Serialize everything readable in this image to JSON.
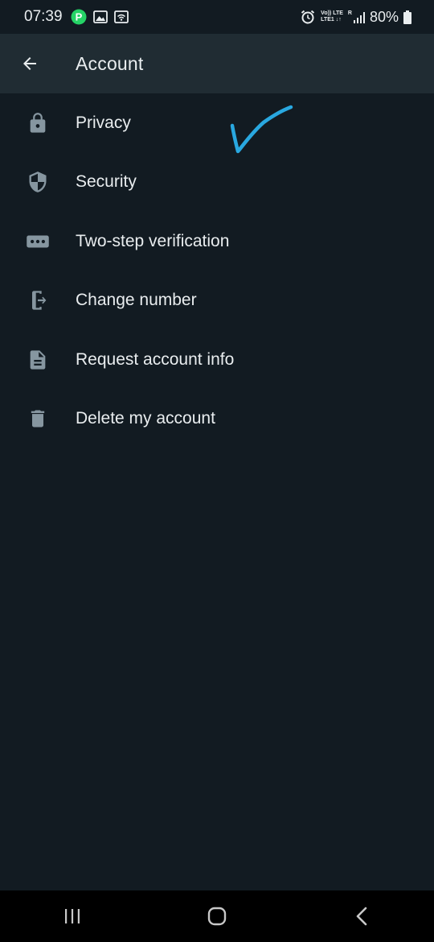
{
  "status_bar": {
    "time": "07:39",
    "battery_percent": "80%",
    "network_label_1": "Vo)) LTE",
    "network_label_2": "LTE1 ↓↑",
    "network_label_3": "R"
  },
  "app_bar": {
    "title": "Account"
  },
  "menu": {
    "items": [
      {
        "label": "Privacy",
        "icon": "lock-icon"
      },
      {
        "label": "Security",
        "icon": "shield-icon"
      },
      {
        "label": "Two-step verification",
        "icon": "dots-password-icon"
      },
      {
        "label": "Change number",
        "icon": "change-number-icon"
      },
      {
        "label": "Request account info",
        "icon": "document-icon"
      },
      {
        "label": "Delete my account",
        "icon": "trash-icon"
      }
    ]
  },
  "colors": {
    "background": "#121b22",
    "app_bar": "#202c33",
    "text": "#e9edef",
    "icon": "#8696a0",
    "annotation": "#29a8e0",
    "notification_badge": "#25d366"
  }
}
